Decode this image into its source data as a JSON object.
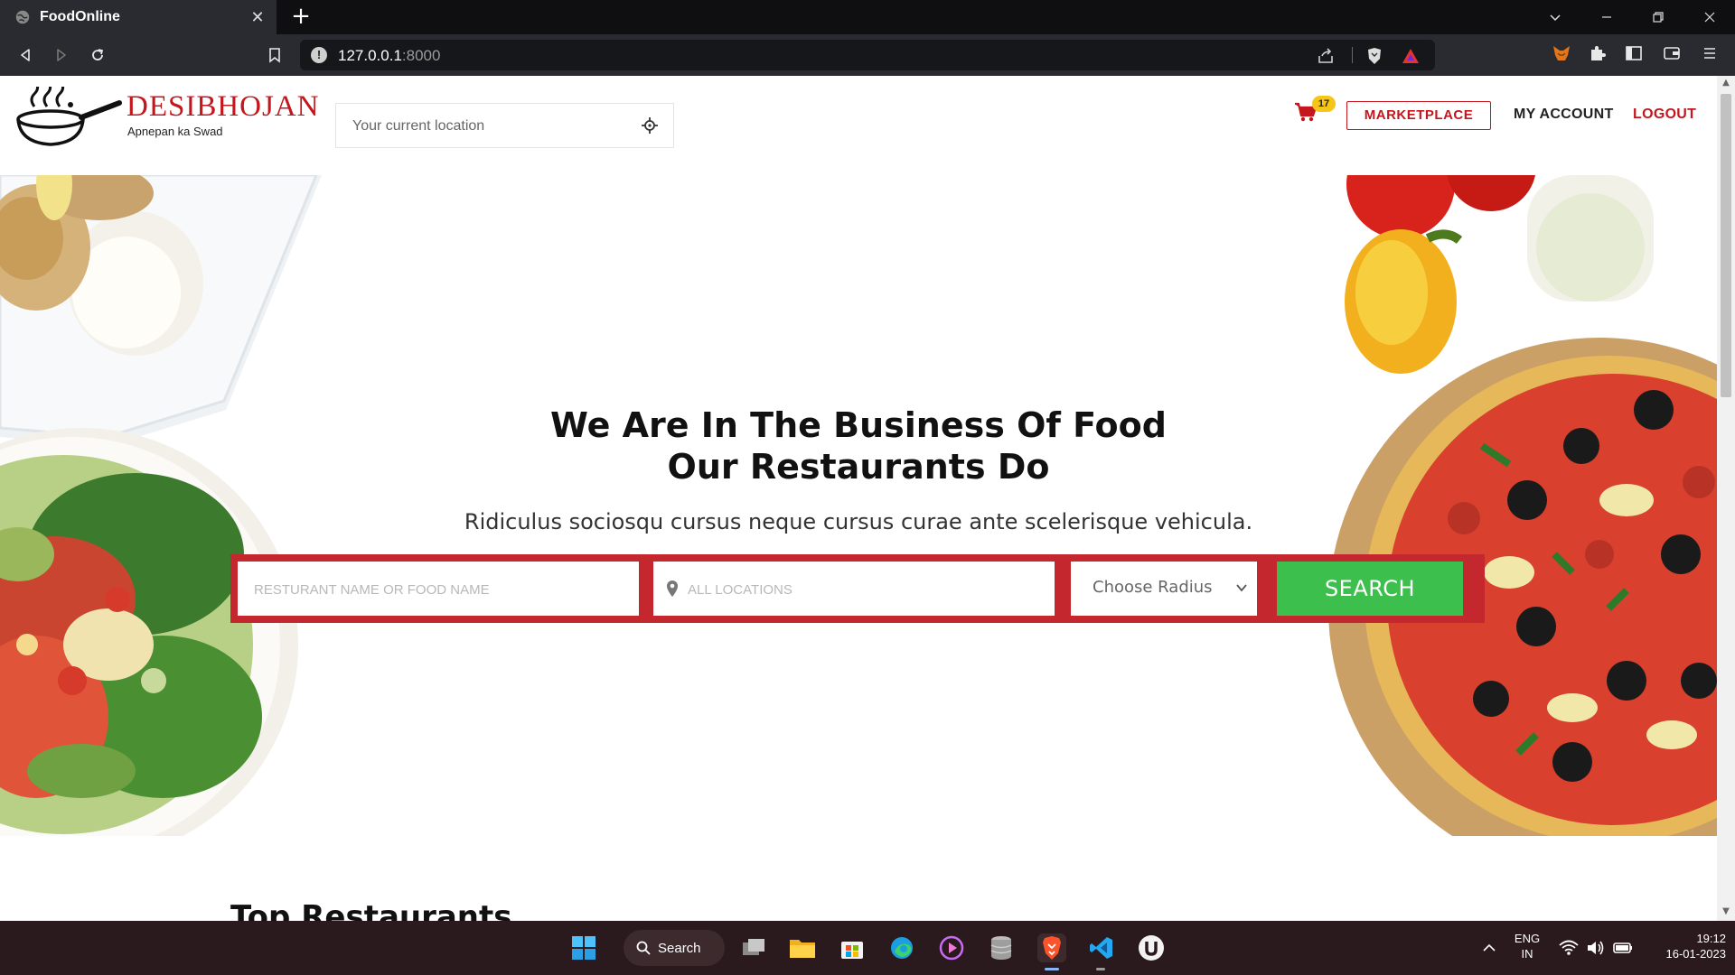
{
  "browser": {
    "tab_title": "FoodOnline",
    "url_host": "127.0.0.1",
    "url_port": ":8000"
  },
  "header": {
    "brand": "DESIBHOJAN",
    "tagline": "Apnepan ka Swad",
    "location_placeholder": "Your current location",
    "cart_count": "17",
    "marketplace": "MARKETPLACE",
    "my_account": "MY ACCOUNT",
    "logout": "LOGOUT"
  },
  "hero": {
    "title_line1": "We Are In The Business Of Food",
    "title_line2": "Our Restaurants Do",
    "subtitle": "Ridiculus sociosqu cursus neque cursus curae ante scelerisque vehicula.",
    "search_placeholder": "RESTURANT NAME OR FOOD NAME",
    "location_placeholder": "ALL LOCATIONS",
    "radius_value": "Choose Radius",
    "search_button": "SEARCH"
  },
  "section": {
    "top_restaurants": "Top Restaurants"
  },
  "taskbar": {
    "search_label": "Search",
    "lang_line1": "ENG",
    "lang_line2": "IN",
    "time": "19:12",
    "date": "16-01-2023"
  },
  "colors": {
    "brand_red": "#c4161c",
    "search_bar_red": "#c4272e",
    "search_green": "#3dbf4e",
    "badge_yellow": "#f5c518"
  }
}
